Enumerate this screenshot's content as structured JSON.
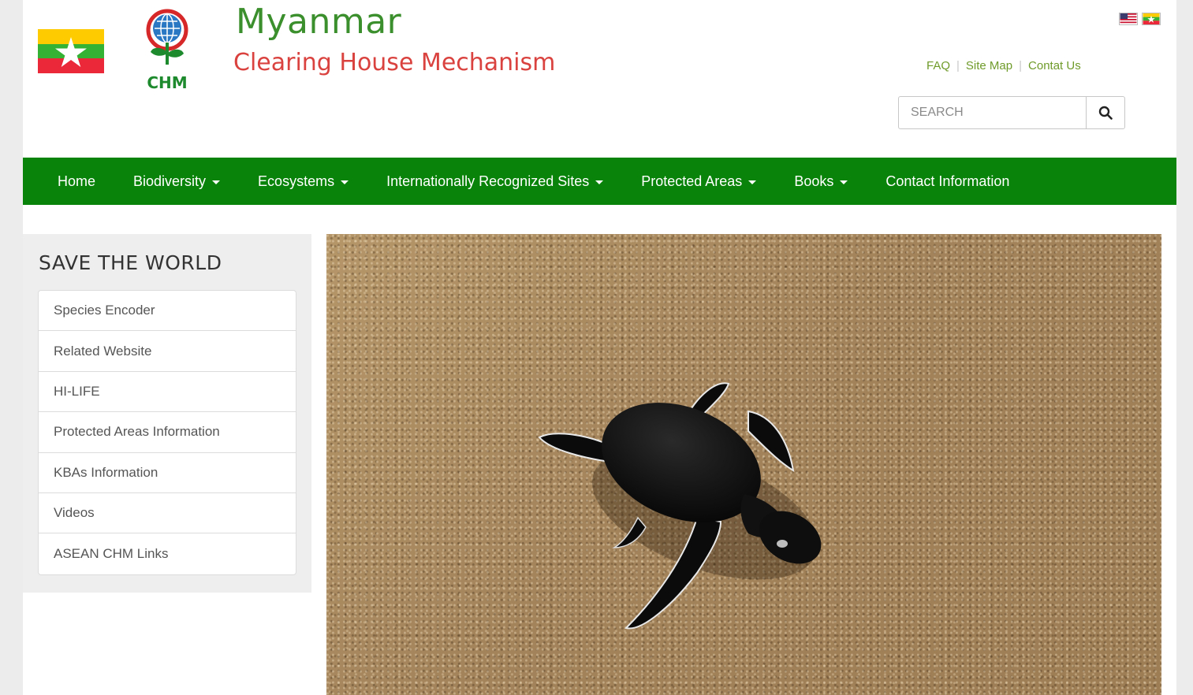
{
  "header": {
    "title": "Myanmar",
    "subtitle": "Clearing House Mechanism",
    "logo_text": "CHM",
    "languages": [
      "English",
      "Myanmar"
    ],
    "top_links": [
      "FAQ",
      "Site Map",
      "Contat Us"
    ],
    "search": {
      "placeholder": "SEARCH",
      "value": "",
      "button_icon": "search-icon"
    }
  },
  "nav": {
    "items": [
      {
        "label": "Home",
        "dropdown": false
      },
      {
        "label": "Biodiversity",
        "dropdown": true
      },
      {
        "label": "Ecosystems",
        "dropdown": true
      },
      {
        "label": "Internationally Recognized Sites",
        "dropdown": true
      },
      {
        "label": "Protected Areas",
        "dropdown": true
      },
      {
        "label": "Books",
        "dropdown": true
      },
      {
        "label": "Contact Information",
        "dropdown": false
      }
    ]
  },
  "sidebar": {
    "heading": "SAVE THE WORLD",
    "items": [
      "Species Encoder",
      "Related Website",
      "HI-LIFE",
      "Protected Areas Information",
      "KBAs Information",
      "Videos",
      "ASEAN CHM Links"
    ]
  },
  "colors": {
    "nav_bg": "#0a830a",
    "title_green": "#3b8f2c",
    "subtitle_red": "#d9423e",
    "link_green": "#6f9b2a"
  }
}
